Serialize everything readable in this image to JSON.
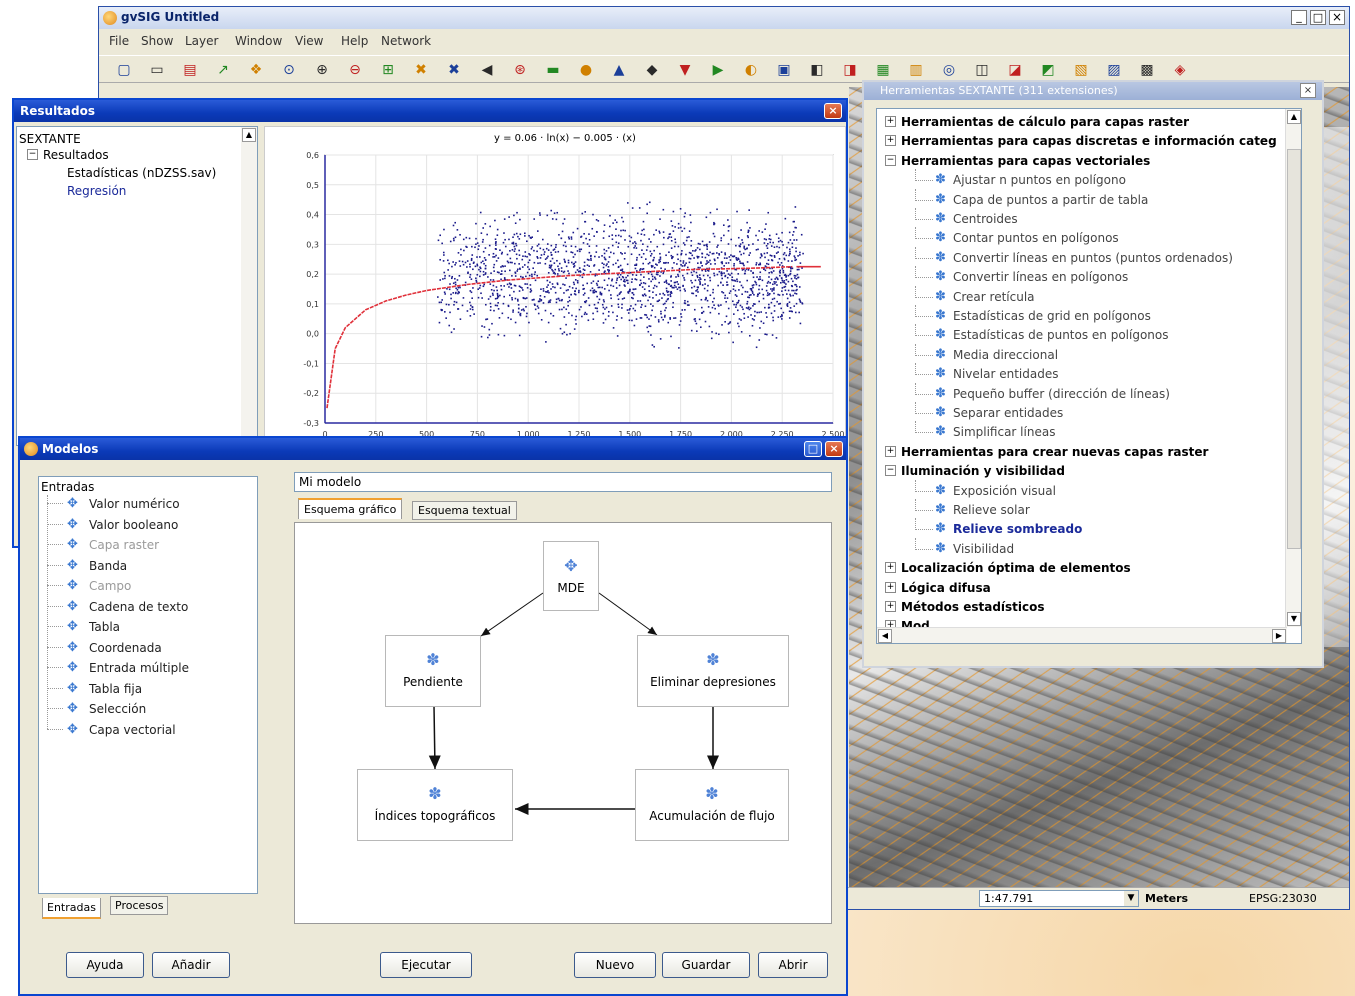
{
  "main_window": {
    "title": "gvSIG Untitled",
    "menu": [
      "File",
      "Show",
      "Layer",
      "Window",
      "View",
      "Help",
      "Network"
    ],
    "controls": {
      "minimize": "_",
      "maximize": "□",
      "close": "×"
    }
  },
  "status_bar": {
    "scale": "1:47.791",
    "units": "Meters",
    "crs": "EPSG:23030"
  },
  "resultados": {
    "title": "Resultados",
    "tree": {
      "root": "SEXTANTE",
      "group": "Resultados",
      "items": [
        "Estadísticas (nDZSS.sav)",
        "Regresión"
      ]
    },
    "chart_title": "y = 0.06 · ln(x) − 0.005 · (x)"
  },
  "chart_data": {
    "type": "scatter",
    "title": "y = 0.06 · ln(x) − 0.005 · (x)",
    "xlabel": "",
    "ylabel": "",
    "xlim": [
      0,
      2500
    ],
    "ylim": [
      -0.3,
      0.6
    ],
    "x_ticks": [
      "0",
      "250",
      "500",
      "750",
      "1.000",
      "1.250",
      "1.500",
      "1.750",
      "2.000",
      "2.250",
      "2.500"
    ],
    "y_ticks": [
      "0,6",
      "0,5",
      "0,4",
      "0,3",
      "0,2",
      "0,1",
      "0,0",
      "-0,1",
      "-0,2",
      "-0,3"
    ],
    "series": [
      {
        "kind": "points",
        "color": "#1a1a8a",
        "x_range": [
          550,
          2350
        ],
        "y_center": 0.2,
        "y_spread": 0.22,
        "count": 1800
      },
      {
        "kind": "fit",
        "color": "#e0303a",
        "x": [
          10,
          50,
          100,
          200,
          300,
          400,
          500,
          700,
          900,
          1200,
          1500,
          1800,
          2100,
          2300
        ],
        "y": [
          -0.25,
          -0.05,
          0.02,
          0.08,
          0.11,
          0.13,
          0.145,
          0.165,
          0.18,
          0.195,
          0.205,
          0.215,
          0.22,
          0.225
        ]
      }
    ]
  },
  "herramientas": {
    "title": "Herramientas SEXTANTE (311 extensiones)",
    "tree": [
      {
        "label": "Herramientas de cálculo para capas raster",
        "level": 0,
        "bold": true,
        "expander": "+"
      },
      {
        "label": "Herramientas para capas discretas e información categ",
        "level": 0,
        "bold": true,
        "expander": "+"
      },
      {
        "label": "Herramientas para capas vectoriales",
        "level": 0,
        "bold": true,
        "expander": "−"
      },
      {
        "label": "Ajustar n puntos en polígono",
        "level": 1
      },
      {
        "label": "Capa de puntos a partir de tabla",
        "level": 1
      },
      {
        "label": "Centroides",
        "level": 1
      },
      {
        "label": "Contar puntos en polígonos",
        "level": 1
      },
      {
        "label": "Convertir líneas en puntos (puntos ordenados)",
        "level": 1
      },
      {
        "label": "Convertir líneas en polígonos",
        "level": 1
      },
      {
        "label": "Crear retícula",
        "level": 1
      },
      {
        "label": "Estadísticas de grid en polígonos",
        "level": 1
      },
      {
        "label": "Estadísticas de puntos en polígonos",
        "level": 1
      },
      {
        "label": "Media direccional",
        "level": 1
      },
      {
        "label": "Nivelar entidades",
        "level": 1
      },
      {
        "label": "Pequeño buffer (dirección de líneas)",
        "level": 1
      },
      {
        "label": "Separar entidades",
        "level": 1
      },
      {
        "label": "Simplificar líneas",
        "level": 1
      },
      {
        "label": "Herramientas para crear nuevas capas raster",
        "level": 0,
        "bold": true,
        "expander": "+"
      },
      {
        "label": "Iluminación y visibilidad",
        "level": 0,
        "bold": true,
        "expander": "−"
      },
      {
        "label": "Exposición visual",
        "level": 1
      },
      {
        "label": "Relieve solar",
        "level": 1
      },
      {
        "label": "Relieve sombreado",
        "level": 1,
        "selected": true
      },
      {
        "label": "Visibilidad",
        "level": 1
      },
      {
        "label": "Localización óptima de elementos",
        "level": 0,
        "bold": true,
        "expander": "+"
      },
      {
        "label": "Lógica difusa",
        "level": 0,
        "bold": true,
        "expander": "+"
      },
      {
        "label": "Métodos estadísticos",
        "level": 0,
        "bold": true,
        "expander": "+"
      },
      {
        "label": "Mod...",
        "level": 0,
        "bold": true,
        "expander": "+"
      }
    ]
  },
  "modelos": {
    "title": "Modelos",
    "model_name": "Mi modelo",
    "tabs": [
      "Esquema gráfico",
      "Esquema textual"
    ],
    "inputs_root": "Entradas",
    "inputs": [
      "Valor numérico",
      "Valor booleano",
      "Capa raster",
      "Banda",
      "Campo",
      "Cadena de texto",
      "Tabla",
      "Coordenada",
      "Entrada múltiple",
      "Tabla fija",
      "Selección",
      "Capa vectorial"
    ],
    "inputs_disabled": [
      2,
      4
    ],
    "left_tabs": [
      "Entradas",
      "Procesos"
    ],
    "nodes": {
      "mde": "MDE",
      "pendiente": "Pendiente",
      "eliminar": "Eliminar depresiones",
      "indices": "Índices topográficos",
      "acumulacion": "Acumulación de flujo"
    },
    "buttons": {
      "ayuda": "Ayuda",
      "anadir": "Añadir",
      "ejecutar": "Ejecutar",
      "nuevo": "Nuevo",
      "guardar": "Guardar",
      "abrir": "Abrir"
    }
  }
}
